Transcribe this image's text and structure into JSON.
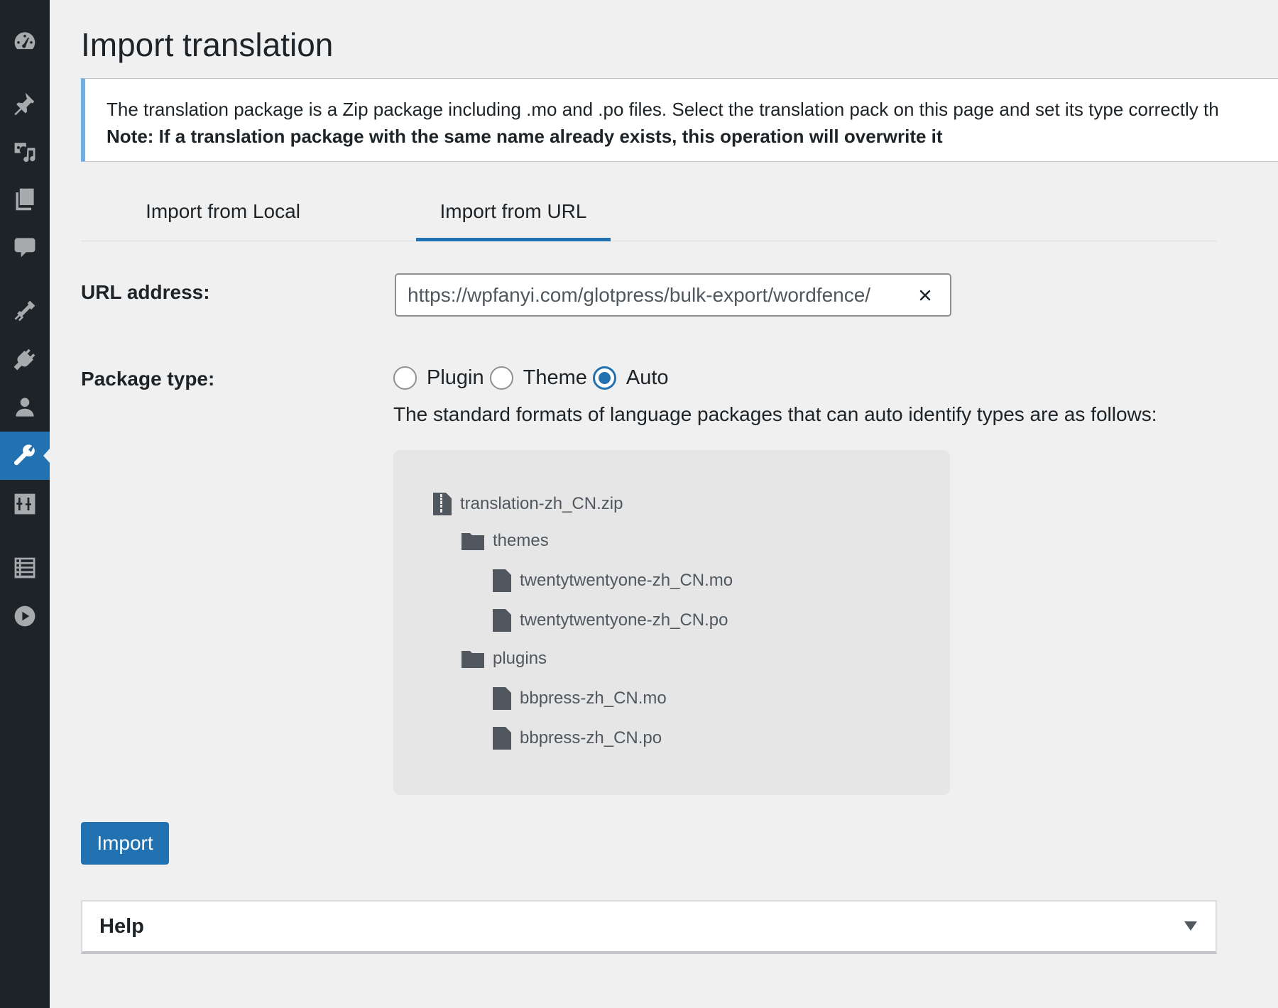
{
  "sidebar": {
    "items": [
      {
        "icon": "dashboard-icon"
      },
      {
        "icon": "pin-icon"
      },
      {
        "icon": "media-icon"
      },
      {
        "icon": "pages-icon"
      },
      {
        "icon": "comments-icon"
      },
      {
        "icon": "appearance-icon"
      },
      {
        "icon": "plugins-icon"
      },
      {
        "icon": "users-icon"
      },
      {
        "icon": "tools-icon",
        "active": true
      },
      {
        "icon": "settings-icon"
      },
      {
        "icon": "list-icon"
      },
      {
        "icon": "play-icon"
      }
    ]
  },
  "page": {
    "title": "Import translation"
  },
  "notice": {
    "line1": "The translation package is a Zip package including .mo and .po files. Select the translation pack on this page and set its type correctly th",
    "line2": "Note: If a translation package with the same name already exists, this operation will overwrite it"
  },
  "tabs": {
    "local": "Import from Local",
    "url": "Import from URL",
    "active": "url"
  },
  "form": {
    "url_label": "URL address:",
    "url_value": "https://wpfanyi.com/glotpress/bulk-export/wordfence/",
    "package_label": "Package type:",
    "options": {
      "plugin": "Plugin",
      "theme": "Theme",
      "auto": "Auto"
    },
    "selected": "auto",
    "description": "The standard formats of language packages that can auto identify types are as follows:"
  },
  "tree": {
    "zip": "translation-zh_CN.zip",
    "themes_folder": "themes",
    "theme_mo": "twentytwentyone-zh_CN.mo",
    "theme_po": "twentytwentyone-zh_CN.po",
    "plugins_folder": "plugins",
    "plugin_mo": "bbpress-zh_CN.mo",
    "plugin_po": "bbpress-zh_CN.po"
  },
  "actions": {
    "import": "Import"
  },
  "help": {
    "title": "Help"
  },
  "colors": {
    "accent": "#2271b1",
    "sidebar_bg": "#1d2327",
    "notice_border": "#72aee6"
  }
}
